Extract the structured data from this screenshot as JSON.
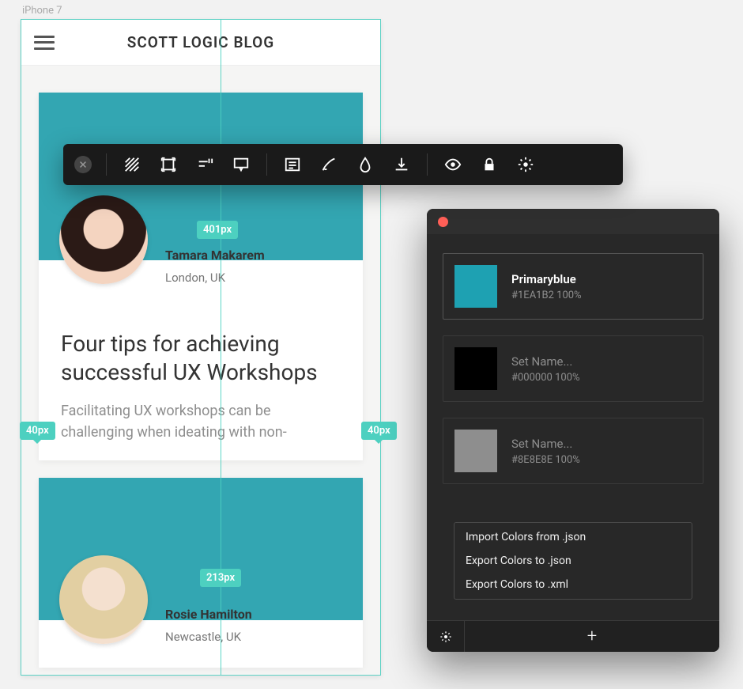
{
  "device_label": "iPhone 7",
  "app": {
    "title": "SCOTT LOGIC BLOG"
  },
  "guides": {
    "top_badge": "401px",
    "left_badge": "40px",
    "right_badge": "40px",
    "mid_badge": "213px"
  },
  "cards": [
    {
      "author_name": "Tamara Makarem",
      "author_location": "London, UK",
      "title": "Four tips for achieving successful UX Workshops",
      "excerpt": "Facilitating UX workshops can be challenging when ideating with non-"
    },
    {
      "author_name": "Rosie Hamilton",
      "author_location": "Newcastle, UK",
      "title": "",
      "excerpt": ""
    }
  ],
  "toolbar": {
    "items": [
      "close",
      "sep",
      "fill-pattern",
      "artboard",
      "align",
      "comment",
      "sep",
      "list",
      "brush",
      "drop",
      "download",
      "sep",
      "eye",
      "lock",
      "gear"
    ]
  },
  "panel": {
    "swatches": [
      {
        "name": "Primaryblue",
        "hex": "#1EA1B2",
        "opacity": "100%",
        "color": "#1EA1B2",
        "placeholder": false
      },
      {
        "name": "Set Name...",
        "hex": "#000000",
        "opacity": "100%",
        "color": "#000000",
        "placeholder": true
      },
      {
        "name": "Set Name...",
        "hex": "#8E8E8E",
        "opacity": "100%",
        "color": "#8E8E8E",
        "placeholder": true
      }
    ],
    "menu": [
      "Import Colors from .json",
      "Export Colors to .json",
      "Export Colors to .xml"
    ]
  }
}
